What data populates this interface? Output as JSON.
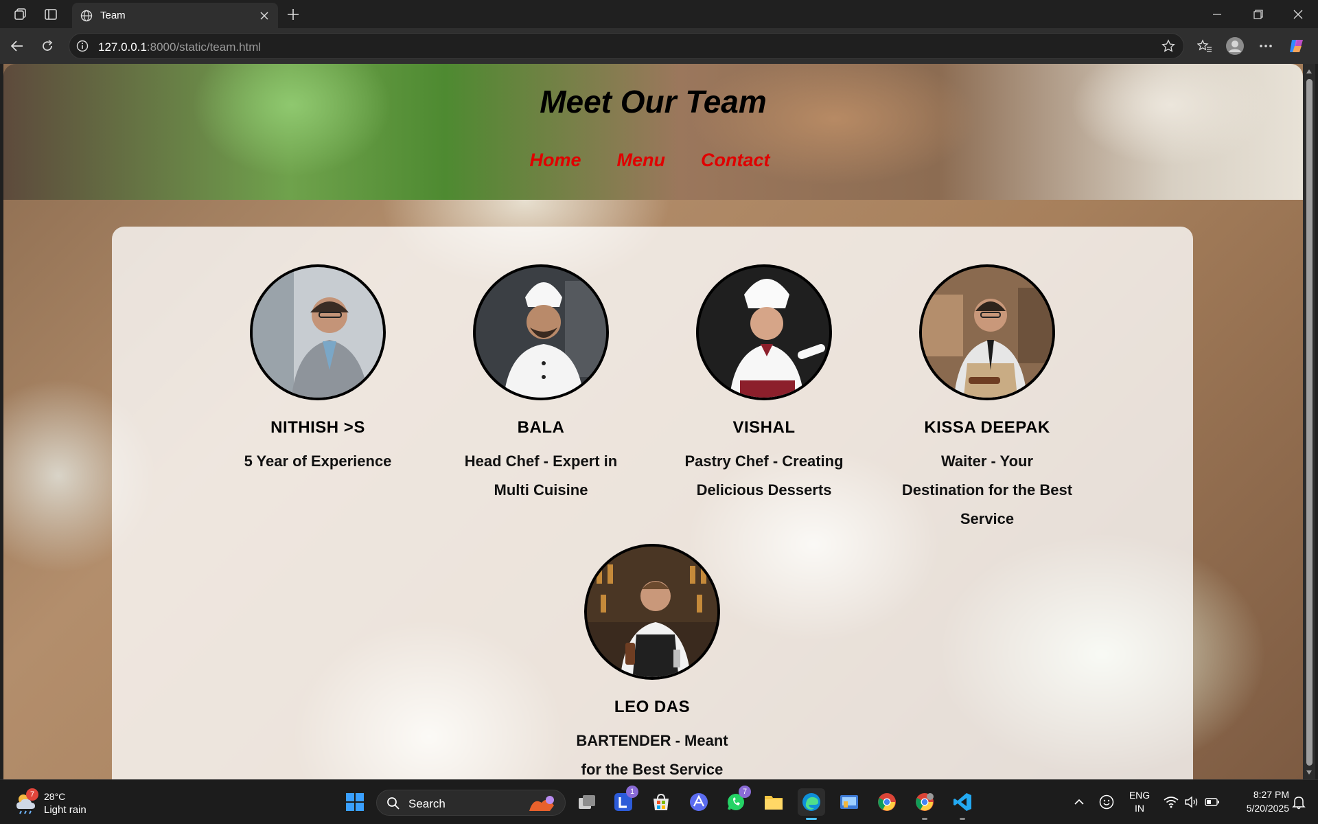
{
  "browser": {
    "tab_title": "Team",
    "url_host": "127.0.0.1",
    "url_rest": ":8000/static/team.html"
  },
  "page": {
    "title": "Meet Our Team",
    "nav": [
      "Home",
      "Menu",
      "Contact"
    ]
  },
  "team": [
    {
      "name": "NITHISH >S",
      "role": "5 Year of Experience",
      "photo_bg": "#c7ccd1",
      "shirt": "#8e949b"
    },
    {
      "name": "BALA",
      "role": "Head Chef - Expert in Multi Cuisine",
      "photo_bg": "#3b3f44",
      "shirt": "#f4f4f4"
    },
    {
      "name": "VISHAL",
      "role": "Pastry Chef - Creating Delicious Desserts",
      "photo_bg": "#1f1f1f",
      "shirt": "#f7f7f7"
    },
    {
      "name": "KISSA DEEPAK",
      "role": "Waiter - Your Destination for the Best Service",
      "photo_bg": "#8a6a4f",
      "shirt": "#e6e6e6"
    },
    {
      "name": "LEO DAS",
      "role": "BARTENDER - Meant for the Best Service",
      "photo_bg": "#3a2a1e",
      "shirt": "#202020"
    }
  ],
  "taskbar": {
    "weather_badge": "7",
    "weather_temp": "28°C",
    "weather_desc": "Light rain",
    "search_label": "Search",
    "lang_top": "ENG",
    "lang_bottom": "IN",
    "time": "8:27 PM",
    "date": "5/20/2025",
    "badge_l": "1",
    "badge_whatsapp": "7"
  },
  "colors": {
    "accent_link": "#e00000",
    "edge_accent": "#4cc2ff"
  }
}
